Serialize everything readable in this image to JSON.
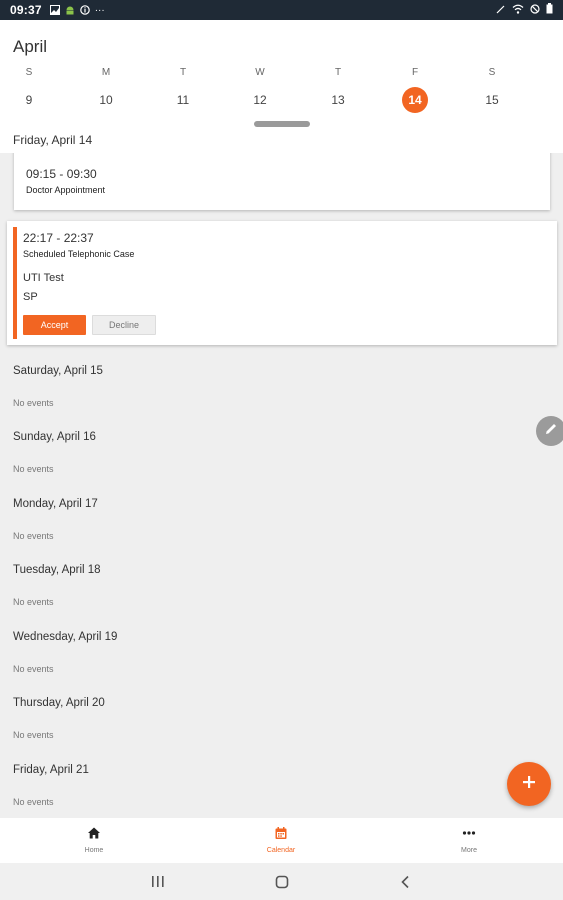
{
  "status_bar": {
    "time": "09:37",
    "more": "···"
  },
  "header": {
    "month": "April",
    "days": [
      {
        "dow": "S",
        "num": "9"
      },
      {
        "dow": "M",
        "num": "10"
      },
      {
        "dow": "T",
        "num": "11"
      },
      {
        "dow": "W",
        "num": "12"
      },
      {
        "dow": "T",
        "num": "13"
      },
      {
        "dow": "F",
        "num": "14",
        "selected": true
      },
      {
        "dow": "S",
        "num": "15"
      }
    ],
    "selected_date_label": "Friday, April 14"
  },
  "events": [
    {
      "time": "09:15 - 09:30",
      "title": "Doctor Appointment"
    },
    {
      "time": "22:17 - 22:37",
      "title": "Scheduled Telephonic Case",
      "name": "UTI Test",
      "initials": "SP",
      "accept_label": "Accept",
      "decline_label": "Decline"
    }
  ],
  "upcoming_days": [
    {
      "label": "Saturday, April 15",
      "empty": "No events"
    },
    {
      "label": "Sunday, April 16",
      "empty": "No events"
    },
    {
      "label": "Monday, April 17",
      "empty": "No events"
    },
    {
      "label": "Tuesday, April 18",
      "empty": "No events"
    },
    {
      "label": "Wednesday, April 19",
      "empty": "No events"
    },
    {
      "label": "Thursday, April 20",
      "empty": "No events"
    },
    {
      "label": "Friday, April 21",
      "empty": "No events"
    }
  ],
  "bottom_nav": [
    {
      "label": "Home",
      "icon": "home-icon",
      "active": false
    },
    {
      "label": "Calendar",
      "icon": "calendar-icon",
      "active": true
    },
    {
      "label": "More",
      "icon": "more-icon",
      "active": false
    }
  ],
  "colors": {
    "accent": "#f26522",
    "status_bar": "#1f2a36",
    "background": "#efefef"
  }
}
